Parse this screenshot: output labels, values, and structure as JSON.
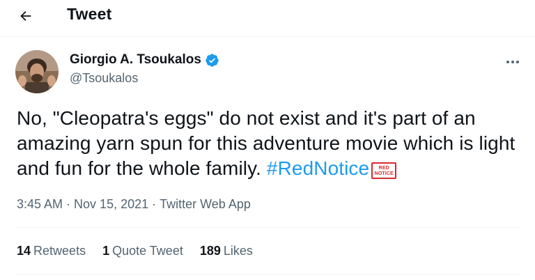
{
  "header": {
    "back_icon": "arrow-left-icon",
    "title": "Tweet"
  },
  "tweet": {
    "author": {
      "name": "Giorgio A. Tsoukalos",
      "handle": "@Tsoukalos",
      "verified": true,
      "verified_color": "#1d9bf0"
    },
    "more_icon": "more-horizontal-icon",
    "text_plain": "No, \"Cleopatra's eggs\" do not exist and it's part of an amazing yarn spun for this adventure movie which is light and fun for the whole family. ",
    "hashtag": "#RedNotice",
    "hashtag_emoji_text": "RED NOTICE",
    "hashtag_color": "#1d9bf0",
    "time": "3:45 AM",
    "date": "Nov 15, 2021",
    "source": "Twitter Web App",
    "separator": "·"
  },
  "stats": {
    "retweets": {
      "count": "14",
      "label": "Retweets"
    },
    "quotes": {
      "count": "1",
      "label": "Quote Tweet"
    },
    "likes": {
      "count": "189",
      "label": "Likes"
    }
  }
}
